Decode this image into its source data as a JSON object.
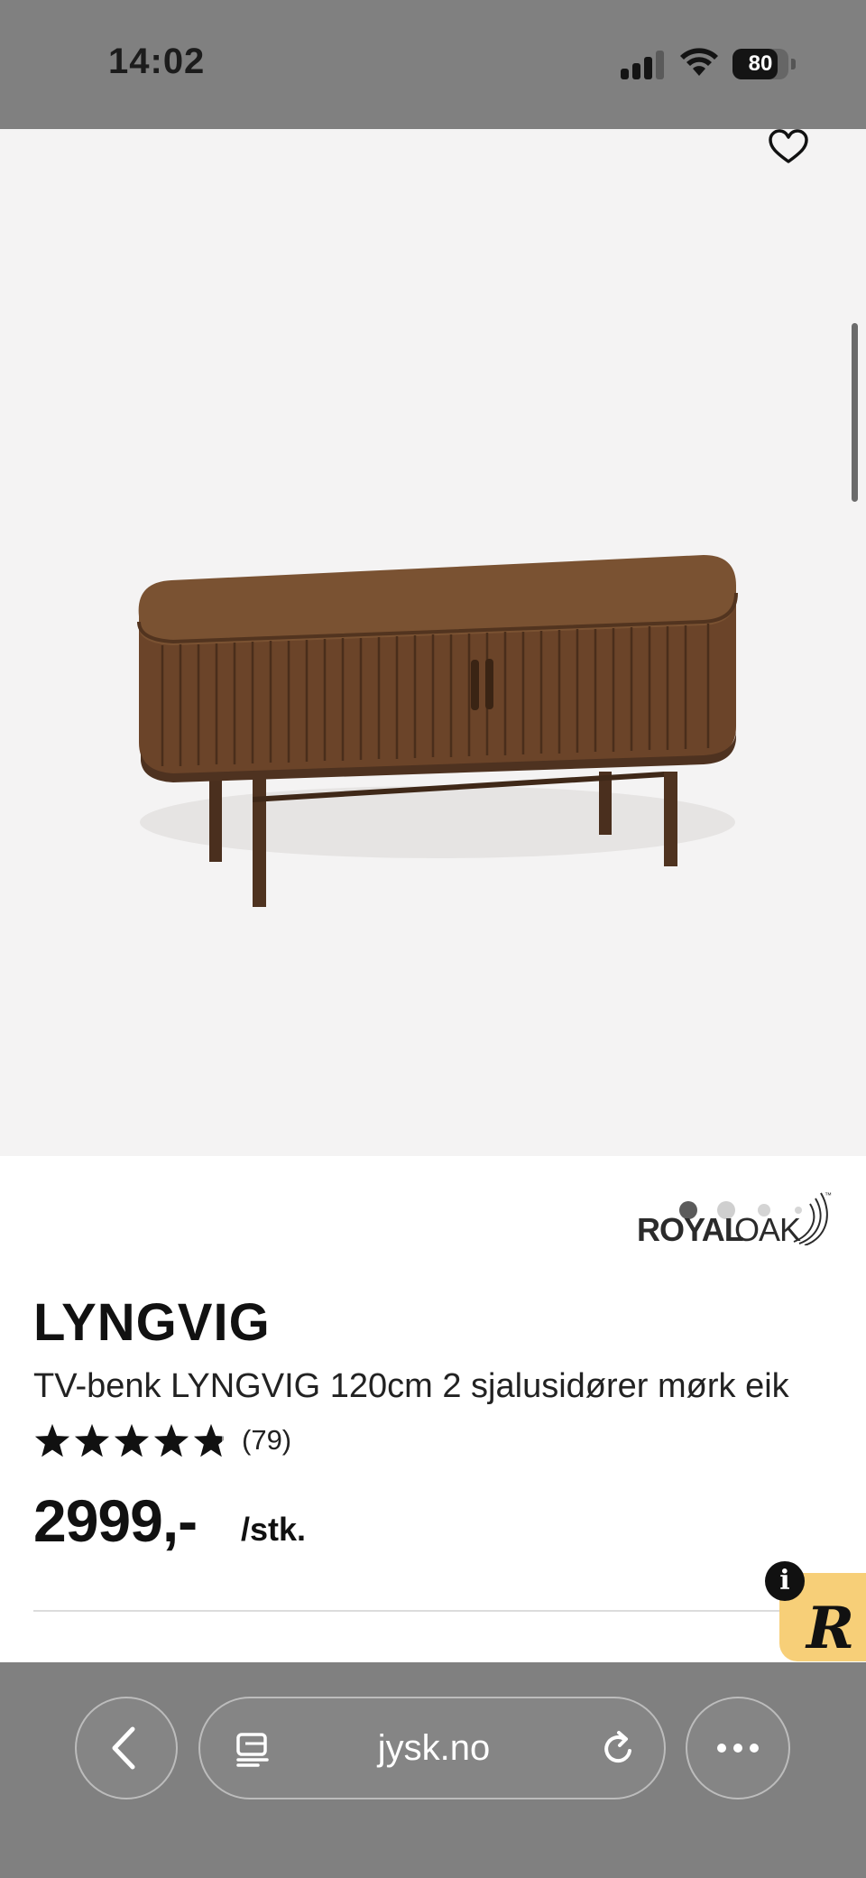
{
  "status_bar": {
    "time": "14:02",
    "battery": "80",
    "icons": [
      "cellular-signal-icon",
      "wifi-icon",
      "battery-icon"
    ]
  },
  "product": {
    "brand_logo": {
      "royal": "ROYAL",
      "oak": "OAK",
      "tm": "™"
    },
    "title": "LYNGVIG",
    "description": "TV-benk LYNGVIG 120cm 2 sjalusidører mørk eik",
    "rating": {
      "stars": 4.8,
      "max_stars": 5,
      "count_text": "(79)"
    },
    "price": "2999,-",
    "price_unit": "/stk."
  },
  "gallery": {
    "current_image": 1,
    "image_count": 4
  },
  "badge": {
    "info_label": "i",
    "logo_letter": "R"
  },
  "browser": {
    "url": "jysk.no",
    "icons": [
      "back-icon",
      "reader-icon",
      "reload-icon",
      "more-icon"
    ]
  },
  "colors": {
    "status_bar_bg": "#808080",
    "image_bg": "#f4f3f3",
    "badge_yellow": "#f7cf78",
    "text_dark": "#111111"
  }
}
